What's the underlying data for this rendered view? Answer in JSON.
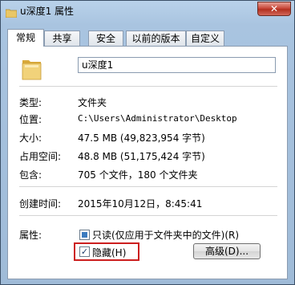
{
  "window": {
    "title": "u深度1 属性",
    "close_label": "✕"
  },
  "tabs": [
    {
      "label": "常规",
      "active": true
    },
    {
      "label": "共享",
      "active": false
    },
    {
      "label": "安全",
      "active": false
    },
    {
      "label": "以前的版本",
      "active": false
    },
    {
      "label": "自定义",
      "active": false
    }
  ],
  "name_field": {
    "value": "u深度1"
  },
  "info": {
    "type_label": "类型:",
    "type_value": "文件夹",
    "location_label": "位置:",
    "location_value": "C:\\Users\\Administrator\\Desktop",
    "size_label": "大小:",
    "size_value": "47.5 MB (49,823,954 字节)",
    "disk_label": "占用空间:",
    "disk_value": "48.8 MB (51,175,424 字节)",
    "contains_label": "包含:",
    "contains_value": "705 个文件，180 个文件夹",
    "created_label": "创建时间:",
    "created_value": "2015年10月12日，8:45:41"
  },
  "attributes": {
    "label": "属性:",
    "readonly_label": "只读(仅应用于文件夹中的文件)(R)",
    "hidden_label": "隐藏(H)",
    "advanced_label": "高级(D)...",
    "hidden_checked": true,
    "readonly_state": "partial"
  },
  "colors": {
    "highlight_box": "#cc1f1f",
    "close_button": "#c9493a"
  }
}
